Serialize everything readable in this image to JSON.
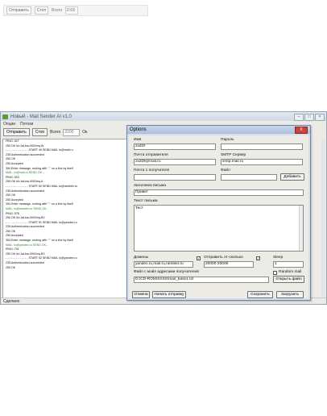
{
  "thumbnail": {
    "send_label": "Отправить",
    "stop_label": "Стоп",
    "total_label": "Всего",
    "total_value": "2000"
  },
  "window": {
    "title": "Новый - Mail Sender AI v1.0",
    "menu": [
      "Опции",
      "Потоки"
    ],
    "toolbar": {
      "send_label": "Отправить",
      "stop_label": "Стоп",
      "total_label": "Всего",
      "total_value": "2000",
      "ok_label": "Ок"
    },
    "log_lines": [
      {
        "text": "PING: 527",
        "color": "#111111"
      },
      {
        "text": "250 OK id=1aUna-0002mq-W",
        "color": "#111111"
      },
      {
        "text": "- - - - - - - - - - - - - START 49 SEND MAIL to@mail.ru",
        "color": "#111111"
      },
      {
        "text": "235 Authentication succeeded",
        "color": "#111111"
      },
      {
        "text": "250 OK",
        "color": "#111111"
      },
      {
        "text": "250 Accepted",
        "color": "#111111"
      },
      {
        "text": "354 Enter message, ending with \".\" on a line by itself",
        "color": "#111111"
      },
      {
        "text": "MAIL: to@mail.ru SEND OK...",
        "color": "#2c8a2c"
      },
      {
        "text": "PING: 503",
        "color": "#111111"
      },
      {
        "text": "250 OK id=1aUna-0002mq-A",
        "color": "#111111"
      },
      {
        "text": "- - - - - - - - - - - - - START 50 SEND MAIL to@rambler.ru",
        "color": "#111111"
      },
      {
        "text": "235 Authentication succeeded",
        "color": "#111111"
      },
      {
        "text": "250 OK",
        "color": "#111111"
      },
      {
        "text": "250 Accepted",
        "color": "#111111"
      },
      {
        "text": "354 Enter message, ending with \".\" on a line by itself",
        "color": "#111111"
      },
      {
        "text": "MAIL: to@rambler.ru SEND OK...",
        "color": "#2c8a2c"
      },
      {
        "text": "PING: 578",
        "color": "#111111"
      },
      {
        "text": "250 OK id=1aUna-0002mq-B2",
        "color": "#111111"
      },
      {
        "text": "- - - - - - - - - - - - - START 51 SEND MAIL to@yandex.ru",
        "color": "#111111"
      },
      {
        "text": "235 Authentication succeeded",
        "color": "#111111"
      },
      {
        "text": "250 OK",
        "color": "#111111"
      },
      {
        "text": "250 Accepted",
        "color": "#111111"
      },
      {
        "text": "354 Enter message, ending with \".\" on a line by itself",
        "color": "#111111"
      },
      {
        "text": "MAIL: to@yandex.ru SEND OK...",
        "color": "#2c8a2c"
      },
      {
        "text": "PING: 701",
        "color": "#111111"
      },
      {
        "text": "250 OK id=1aUna-0002mq-B3",
        "color": "#111111"
      },
      {
        "text": "- - - - - - - - - - - - - START 52 SEND MAIL to@yandex.ru",
        "color": "#111111"
      },
      {
        "text": "235 Authentication succeeded",
        "color": "#111111"
      },
      {
        "text": "250 OK",
        "color": "#111111"
      }
    ],
    "status": "Сделано"
  },
  "dialog": {
    "title": "Options",
    "close_label": "X",
    "name_label": "Имя",
    "name_value": "zxdDf",
    "password_label": "Пароль",
    "password_value": "",
    "sender_label": "Почта отправителя",
    "sender_value": "zxdDf@mail.ru",
    "smtp_label": "SMTP Сервер",
    "smtp_value": "smtp.mail.ru",
    "recipient1_label": "Почта 1 получателя",
    "recipient1_value": "",
    "file_label": "Файл",
    "file_value": "",
    "add_label": "Добавить",
    "subject_label": "Заголовок письма",
    "subject_value": "Привет",
    "body_label": "Текст письма",
    "body_value": "Тест",
    "domains_label": "Домены",
    "domains_value": "yandex.ru,mail.ru,rambler.ru",
    "domains_checked": true,
    "send_from_label": "Отправить от-сколько",
    "send_from_value": "20000-20000",
    "send_from_checked": true,
    "sleep_label": "Sleep",
    "sleep_value": "1",
    "random_mail_label": "Random mail",
    "random_mail_checked": false,
    "recipients_file_label": "Файл с мэйл адресами получателей",
    "recipients_file_value": "D:\\CD-ROM\\SSSS\\mail_base1.txt",
    "open_file_label": "Открыть файл",
    "cancel_label": "Отмена",
    "start_send_label": "Начать отправку",
    "save_label": "Сохранить",
    "load_label": "Загрузить"
  }
}
